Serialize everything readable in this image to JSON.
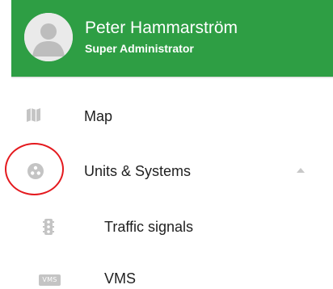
{
  "user": {
    "name": "Peter Hammarström",
    "role": "Super Administrator",
    "avatar_icon": "person-avatar-icon"
  },
  "nav": {
    "items": [
      {
        "label": "Map",
        "icon": "map-icon"
      },
      {
        "label": "Units & Systems",
        "icon": "units-systems-icon",
        "expanded": true,
        "toggle_icon": "chevron-up-icon"
      },
      {
        "label": "Traffic signals",
        "icon": "traffic-signal-icon",
        "sub": true
      },
      {
        "label": "VMS",
        "icon": "vms-icon",
        "icon_text": "VMS",
        "sub": true
      }
    ]
  },
  "colors": {
    "header": "#2e9e44",
    "icon": "#c4c4c4",
    "annotation": "#e4191e"
  }
}
